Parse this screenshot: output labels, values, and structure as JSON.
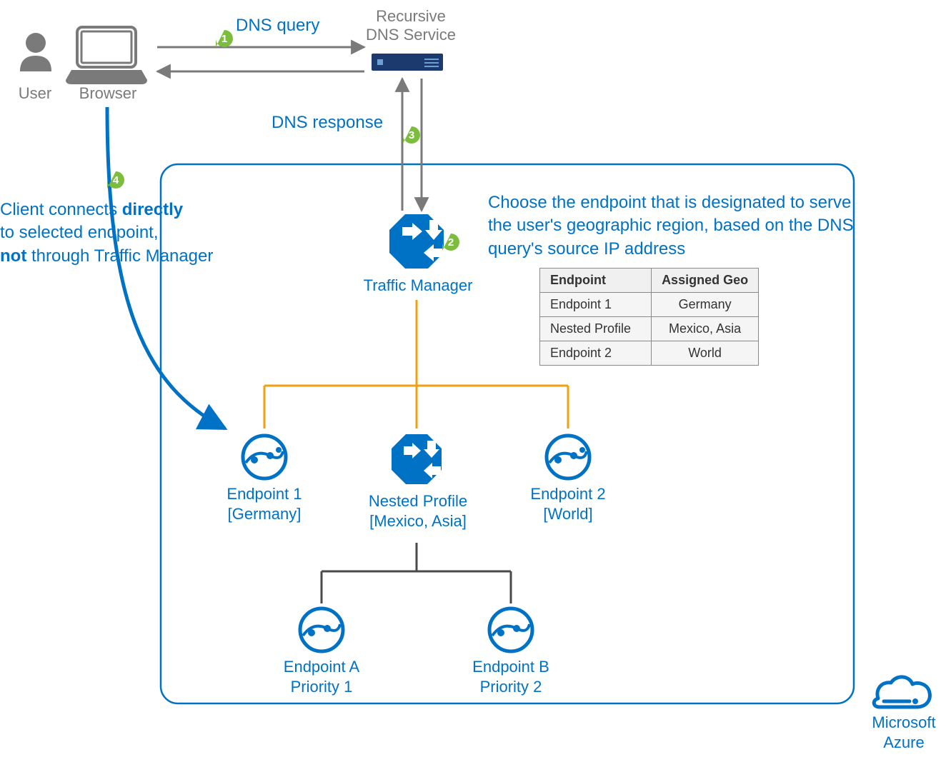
{
  "labels": {
    "user": "User",
    "browser": "Browser",
    "dns_service_l1": "Recursive",
    "dns_service_l2": "DNS Service",
    "traffic_manager": "Traffic Manager",
    "endpoint1_name": "Endpoint 1",
    "endpoint1_geo": "[Germany]",
    "nested_name": "Nested Profile",
    "nested_geo": "[Mexico, Asia]",
    "endpoint2_name": "Endpoint 2",
    "endpoint2_geo": "[World]",
    "endpointA_name": "Endpoint A",
    "endpointA_pri": "Priority 1",
    "endpointB_name": "Endpoint B",
    "endpointB_pri": "Priority 2",
    "azure_l1": "Microsoft",
    "azure_l2": "Azure",
    "dns_query": "DNS query",
    "dns_response": "DNS response"
  },
  "client_text": {
    "l1a": "Client connects ",
    "l1b": "directly",
    "l2": "to selected endpoint,",
    "l3a": "not",
    "l3b": " through Traffic Manager"
  },
  "choose_text": "Choose the endpoint that is designated to serve the user's geographic region, based on the DNS query's source IP address",
  "steps": {
    "s1": "1",
    "s2": "2",
    "s3": "3",
    "s4": "4"
  },
  "table": {
    "hdr_endpoint": "Endpoint",
    "hdr_geo": "Assigned Geo",
    "rows": [
      {
        "endpoint": "Endpoint 1",
        "geo": "Germany"
      },
      {
        "endpoint": "Nested Profile",
        "geo": "Mexico, Asia"
      },
      {
        "endpoint": "Endpoint 2",
        "geo": "World"
      }
    ]
  },
  "colors": {
    "azure_blue": "#0072c6",
    "gray": "#7a7a7a",
    "dark_navy": "#1c3a6e",
    "badge_green": "#7cbd3e",
    "connector_orange": "#f0a011"
  }
}
